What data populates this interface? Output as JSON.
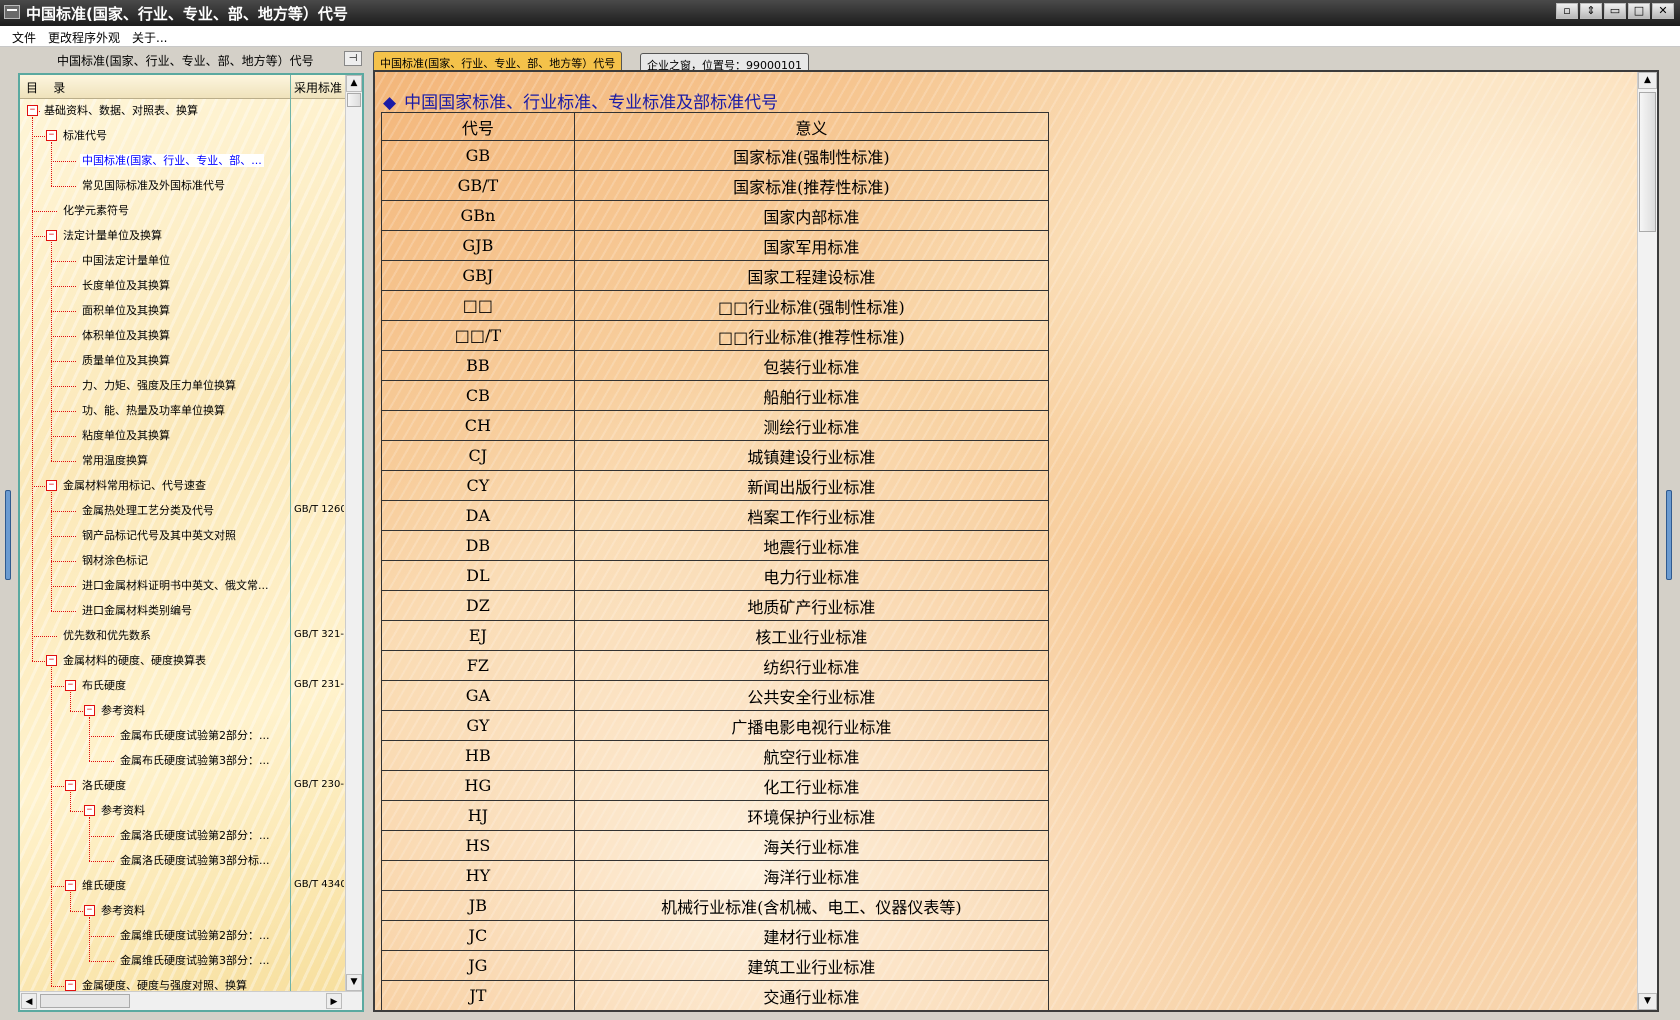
{
  "window": {
    "title": "中国标准(国家、行业、专业、部、地方等）代号",
    "controls": [
      "▫",
      "⇕",
      "▭",
      "□",
      "✕"
    ]
  },
  "menu": [
    "文件",
    "更改程序外观",
    "关于..."
  ],
  "left_panel": {
    "caption": "中国标准(国家、行业、专业、部、地方等）代号",
    "pin_icon": "⊣",
    "col_title": "目    录",
    "col_std": "采用标准"
  },
  "tree": [
    {
      "label": "基础资料、数据、对照表、换算",
      "level": 0,
      "toggle": true,
      "std": ""
    },
    {
      "label": "标准代号",
      "level": 1,
      "toggle": true,
      "std": ""
    },
    {
      "label": "中国标准(国家、行业、专业、部、...",
      "level": 2,
      "toggle": false,
      "std": "",
      "selected": true
    },
    {
      "label": "常见国际标准及外国标准代号",
      "level": 2,
      "toggle": false,
      "std": ""
    },
    {
      "label": "化学元素符号",
      "level": 1,
      "toggle": false,
      "std": ""
    },
    {
      "label": "法定计量单位及换算",
      "level": 1,
      "toggle": true,
      "std": ""
    },
    {
      "label": "中国法定计量单位",
      "level": 2,
      "toggle": false,
      "std": ""
    },
    {
      "label": "长度单位及其换算",
      "level": 2,
      "toggle": false,
      "std": ""
    },
    {
      "label": "面积单位及其换算",
      "level": 2,
      "toggle": false,
      "std": ""
    },
    {
      "label": "体积单位及其换算",
      "level": 2,
      "toggle": false,
      "std": ""
    },
    {
      "label": "质量单位及其换算",
      "level": 2,
      "toggle": false,
      "std": ""
    },
    {
      "label": "力、力矩、强度及压力单位换算",
      "level": 2,
      "toggle": false,
      "std": ""
    },
    {
      "label": "功、能、热量及功率单位换算",
      "level": 2,
      "toggle": false,
      "std": ""
    },
    {
      "label": "粘度单位及其换算",
      "level": 2,
      "toggle": false,
      "std": ""
    },
    {
      "label": "常用温度换算",
      "level": 2,
      "toggle": false,
      "std": ""
    },
    {
      "label": "金属材料常用标记、代号速查",
      "level": 1,
      "toggle": true,
      "std": ""
    },
    {
      "label": "金属热处理工艺分类及代号",
      "level": 2,
      "toggle": false,
      "std": "GB/T 1260"
    },
    {
      "label": "钢产品标记代号及其中英文对照",
      "level": 2,
      "toggle": false,
      "std": ""
    },
    {
      "label": "钢材涂色标记",
      "level": 2,
      "toggle": false,
      "std": ""
    },
    {
      "label": "进口金属材料证明书中英文、俄文常...",
      "level": 2,
      "toggle": false,
      "std": ""
    },
    {
      "label": "进口金属材料类别编号",
      "level": 2,
      "toggle": false,
      "std": ""
    },
    {
      "label": "优先数和优先数系",
      "level": 1,
      "toggle": false,
      "std": "GB/T 321-"
    },
    {
      "label": "金属材料的硬度、硬度换算表",
      "level": 1,
      "toggle": true,
      "std": ""
    },
    {
      "label": "布氏硬度",
      "level": 2,
      "toggle": true,
      "std": "GB/T 231-"
    },
    {
      "label": "参考资料",
      "level": 3,
      "toggle": true,
      "std": ""
    },
    {
      "label": "金属布氏硬度试验第2部分：...",
      "level": 4,
      "toggle": false,
      "std": ""
    },
    {
      "label": "金属布氏硬度试验第3部分：...",
      "level": 4,
      "toggle": false,
      "std": ""
    },
    {
      "label": "洛氏硬度",
      "level": 2,
      "toggle": true,
      "std": "GB/T 230-"
    },
    {
      "label": "参考资料",
      "level": 3,
      "toggle": true,
      "std": ""
    },
    {
      "label": "金属洛氏硬度试验第2部分：...",
      "level": 4,
      "toggle": false,
      "std": ""
    },
    {
      "label": "金属洛氏硬度试验第3部分标...",
      "level": 4,
      "toggle": false,
      "std": ""
    },
    {
      "label": "维氏硬度",
      "level": 2,
      "toggle": true,
      "std": "GB/T 4340"
    },
    {
      "label": "参考资料",
      "level": 3,
      "toggle": true,
      "std": ""
    },
    {
      "label": "金属维氏硬度试验第2部分：...",
      "level": 4,
      "toggle": false,
      "std": ""
    },
    {
      "label": "金属维氏硬度试验第3部分：...",
      "level": 4,
      "toggle": false,
      "std": ""
    },
    {
      "label": "金属硬度、硬度与强度对照、换算",
      "level": 2,
      "toggle": true,
      "std": ""
    }
  ],
  "tabs": [
    {
      "label": "中国标准(国家、行业、专业、部、地方等）代号",
      "active": true
    },
    {
      "label": "企业之窗，位置号：99000101",
      "active": false
    }
  ],
  "content": {
    "heading_icon": "◆",
    "heading": "中国国家标准、行业标准、专业标准及部标准代号",
    "table_headers": [
      "代号",
      "意义"
    ],
    "rows": [
      [
        "GB",
        "国家标准(强制性标准)"
      ],
      [
        "GB/T",
        "国家标准(推荐性标准)"
      ],
      [
        "GBn",
        "国家内部标准"
      ],
      [
        "GJB",
        "国家军用标准"
      ],
      [
        "GBJ",
        "国家工程建设标准"
      ],
      [
        "□□",
        "□□行业标准(强制性标准)"
      ],
      [
        "□□/T",
        "□□行业标准(推荐性标准)"
      ],
      [
        "BB",
        "包装行业标准"
      ],
      [
        "CB",
        "船舶行业标准"
      ],
      [
        "CH",
        "测绘行业标准"
      ],
      [
        "CJ",
        "城镇建设行业标准"
      ],
      [
        "CY",
        "新闻出版行业标准"
      ],
      [
        "DA",
        "档案工作行业标准"
      ],
      [
        "DB",
        "地震行业标准"
      ],
      [
        "DL",
        "电力行业标准"
      ],
      [
        "DZ",
        "地质矿产行业标准"
      ],
      [
        "EJ",
        "核工业行业标准"
      ],
      [
        "FZ",
        "纺织行业标准"
      ],
      [
        "GA",
        "公共安全行业标准"
      ],
      [
        "GY",
        "广播电影电视行业标准"
      ],
      [
        "HB",
        "航空行业标准"
      ],
      [
        "HG",
        "化工行业标准"
      ],
      [
        "HJ",
        "环境保护行业标准"
      ],
      [
        "HS",
        "海关行业标准"
      ],
      [
        "HY",
        "海洋行业标准"
      ],
      [
        "JB",
        "机械行业标准(含机械、电工、仪器仪表等)"
      ],
      [
        "JC",
        "建材行业标准"
      ],
      [
        "JG",
        "建筑工业行业标准"
      ],
      [
        "JT",
        "交通行业标准"
      ]
    ]
  },
  "colors": {
    "accent_tab": "#f4c24a",
    "tree_lines": "#e01010",
    "heading": "#1a1aa6",
    "selected_text": "#0000ff"
  }
}
